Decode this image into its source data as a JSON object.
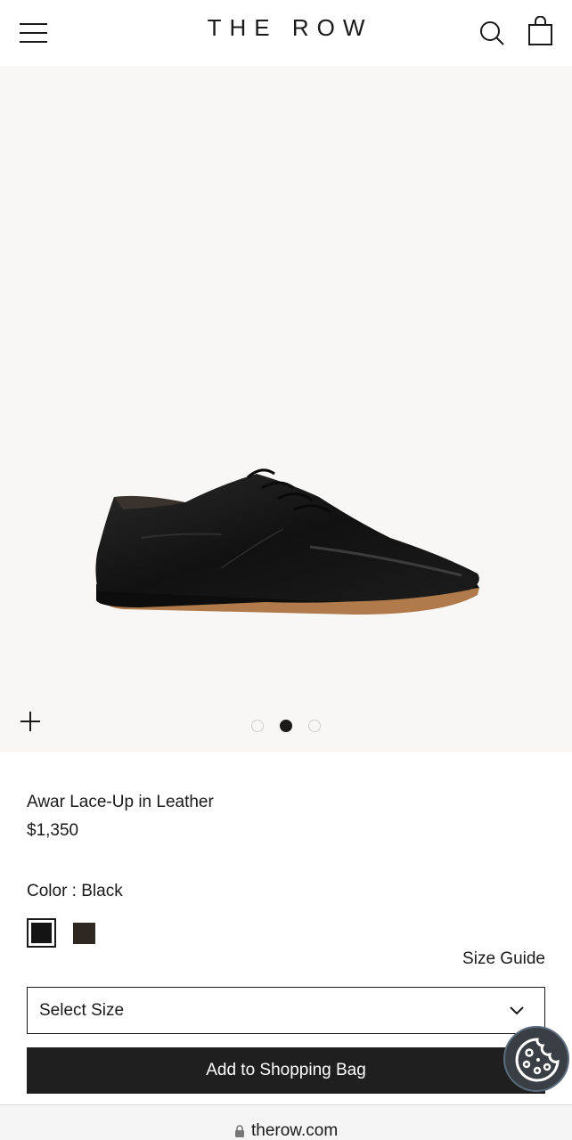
{
  "header": {
    "logo": "THE ROW",
    "menu_icon": "hamburger-icon",
    "search_icon": "search-icon",
    "bag_icon": "shopping-bag-icon"
  },
  "gallery": {
    "zoom_icon": "plus-icon",
    "dots": [
      false,
      true,
      false
    ],
    "background": "#f8f7f6"
  },
  "product": {
    "name": "Awar Lace-Up in Leather",
    "price": "$1,350",
    "color_label": "Color : Black",
    "swatches": [
      "#141414",
      "#2f2722"
    ],
    "size_guide": "Size Guide",
    "select_size": "Select Size",
    "add_to_bag": "Add to Shopping Bag"
  },
  "browser": {
    "url": "therow.com"
  },
  "colors": {
    "button_bg": "#1f1f1f",
    "cookie_bg": "#3a3f45"
  }
}
